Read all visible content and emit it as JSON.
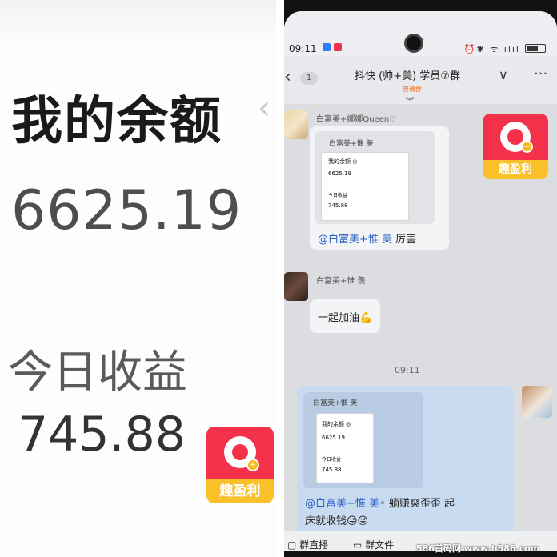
{
  "left_panel": {
    "balance_title": "我的余额",
    "back_chevron": "‹",
    "balance_value": "6625.19",
    "today_title": "今日收益",
    "today_value": "745.88",
    "app_badge_label": "趣盈利"
  },
  "phone": {
    "status_time": "09:11",
    "status_icons": "⏰✱ ᯤ ılıl",
    "header": {
      "back_icon": "‹",
      "unread_count": "1",
      "group_title": "抖快 (帅+美) 学员⑦群",
      "group_tag": "普通群",
      "chevron": "∨",
      "more": "···",
      "collapse": "︾"
    },
    "messages": [
      {
        "sender": "白富美+娜娜Queen♡",
        "quote_name": "白富美+惟 美",
        "mini_title": "我的余额 ◎",
        "mini_value": "6625.19",
        "mini_today_title": "今日收益",
        "mini_today_value": "745.88",
        "mention": "@白富美+惟 美",
        "text": " 厉害"
      },
      {
        "sender": "白富美+惟 羡",
        "text": "一起加油💪"
      },
      {
        "quote_name": "白富美+惟 美",
        "mini_title": "我的余额 ◎",
        "mini_value": "6625.19",
        "mini_today_title": "今日收益",
        "mini_today_value": "745.88",
        "mention": "@白富美+惟 美",
        "text_line1": "◦ 躺赚爽歪歪 起",
        "text_line2": "床就收钱😜😜"
      }
    ],
    "timestamp": "09:11",
    "app_badge_label": "趣盈利",
    "bottom_bar": {
      "item1": "▢ 群直播",
      "item2": "▭ 群文件"
    }
  },
  "watermark": "586首码网 www.h586.com"
}
